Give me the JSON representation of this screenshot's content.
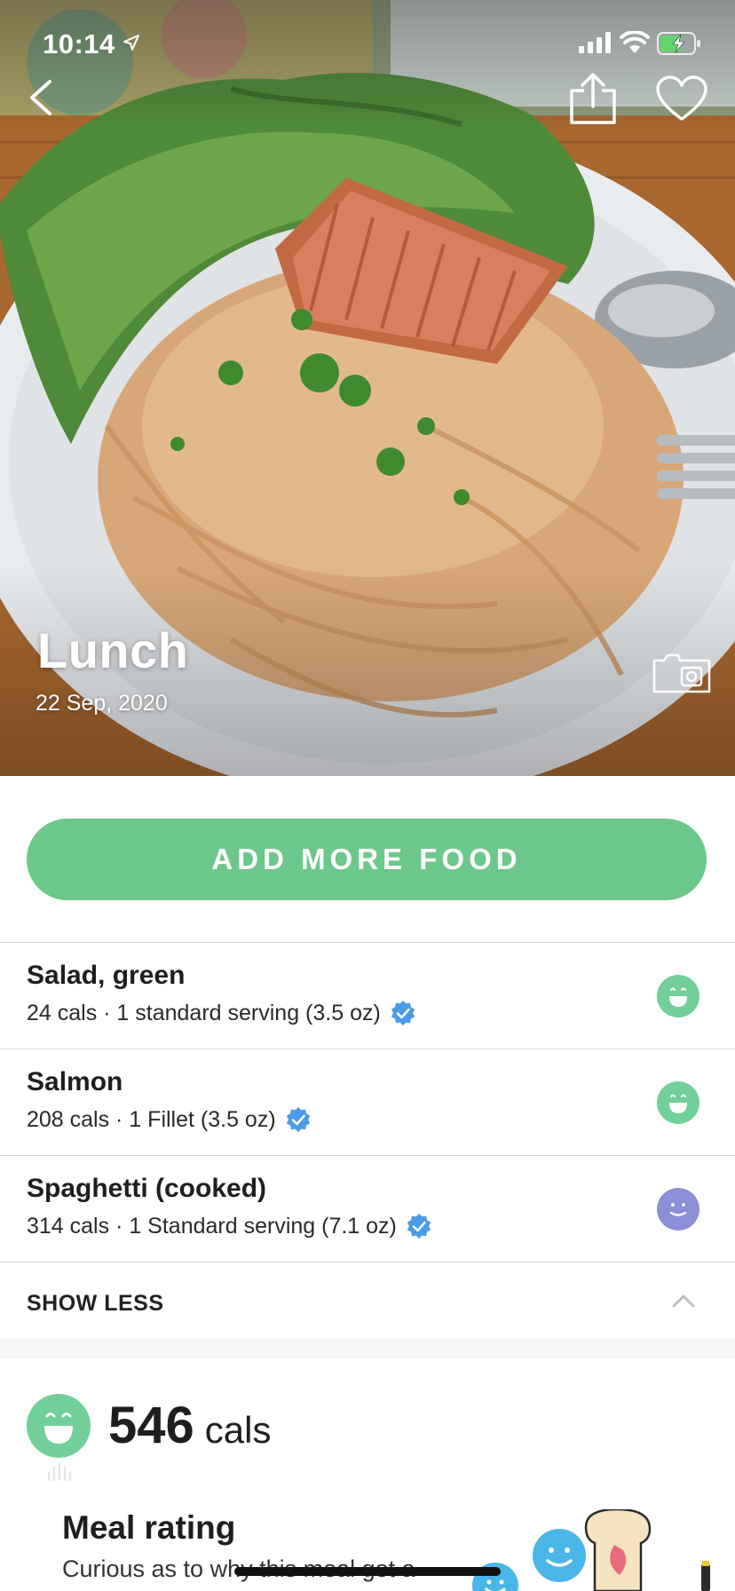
{
  "status_bar": {
    "time": "10:14",
    "location_icon": "location-arrow-icon",
    "signal_icon": "cellular-signal-icon",
    "wifi_icon": "wifi-icon",
    "battery_icon": "battery-charging-icon"
  },
  "hero": {
    "meal_name": "Lunch",
    "date": "22 Sep, 2020"
  },
  "actions": {
    "add_food_label": "ADD MORE FOOD"
  },
  "foods": [
    {
      "name": "Salad, green",
      "detail": "24 cals · 1 standard serving (3.5 oz)",
      "rating": "very-healthy"
    },
    {
      "name": "Salmon",
      "detail": "208 cals · 1 Fillet (3.5 oz)",
      "rating": "very-healthy"
    },
    {
      "name": "Spaghetti (cooked)",
      "detail": "314 cals · 1 Standard serving (7.1 oz)",
      "rating": "neutral"
    }
  ],
  "show_less_label": "SHOW LESS",
  "summary": {
    "calories": "546",
    "unit": "cals"
  },
  "meal_rating": {
    "title": "Meal rating",
    "description": "Curious as to why this meal got a"
  },
  "colors": {
    "accent_green": "#6cc78a",
    "rating_green": "#72cf9a",
    "rating_purple": "#8a8fd6",
    "verified_blue": "#4a9ce8"
  }
}
